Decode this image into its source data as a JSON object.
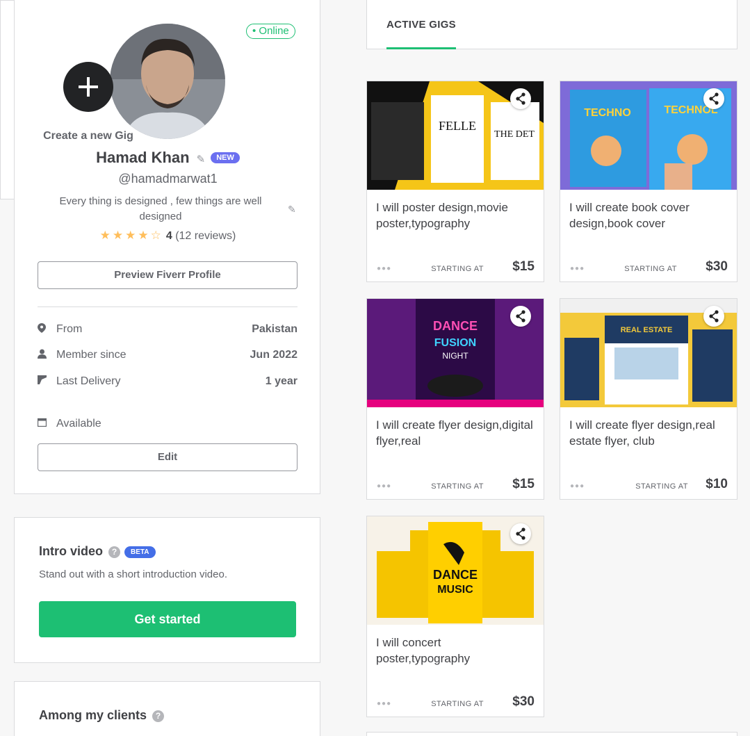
{
  "profile": {
    "status": "• Online",
    "name": "Hamad Khan",
    "badge": "NEW",
    "username": "@hamadmarwat1",
    "description": "Every thing is designed , few things are well designed",
    "rating_value": "4",
    "reviews": "(12 reviews)",
    "preview_button": "Preview Fiverr Profile",
    "info": [
      {
        "label": "From",
        "value": "Pakistan",
        "icon": "location-pin-icon"
      },
      {
        "label": "Member since",
        "value": "Jun 2022",
        "icon": "user-icon"
      },
      {
        "label": "Last Delivery",
        "value": "1 year",
        "icon": "paper-plane-icon"
      }
    ],
    "availability": "Available",
    "edit_button": "Edit"
  },
  "intro": {
    "title": "Intro video",
    "badge": "BETA",
    "help": "?",
    "subtitle": "Stand out with a short introduction video.",
    "cta": "Get started"
  },
  "clients": {
    "title": "Among my clients",
    "help": "?"
  },
  "tabs": {
    "active": "ACTIVE GIGS"
  },
  "gigs": [
    {
      "title": "I will poster design,movie poster,typography",
      "starting": "STARTING AT",
      "price": "$15",
      "dots": "●●●"
    },
    {
      "title": "I will create book cover design,book cover",
      "starting": "STARTING AT",
      "price": "$30",
      "dots": "●●●"
    },
    {
      "title": "I will create flyer design,digital flyer,real",
      "starting": "STARTING AT",
      "price": "$15",
      "dots": "●●●"
    },
    {
      "title": "I will create flyer design,real estate flyer, club",
      "starting": "STARTING AT",
      "price": "$10",
      "dots": "●●●"
    },
    {
      "title": "I will concert poster,typography",
      "starting": "STARTING AT",
      "price": "$30",
      "dots": "●●●"
    }
  ],
  "create_gig": {
    "label": "Create a new Gig"
  },
  "colors": {
    "accent": "#1dbf73",
    "new_badge": "#6b6ff0",
    "beta_badge": "#446ee7",
    "star": "#ffbe5b"
  }
}
